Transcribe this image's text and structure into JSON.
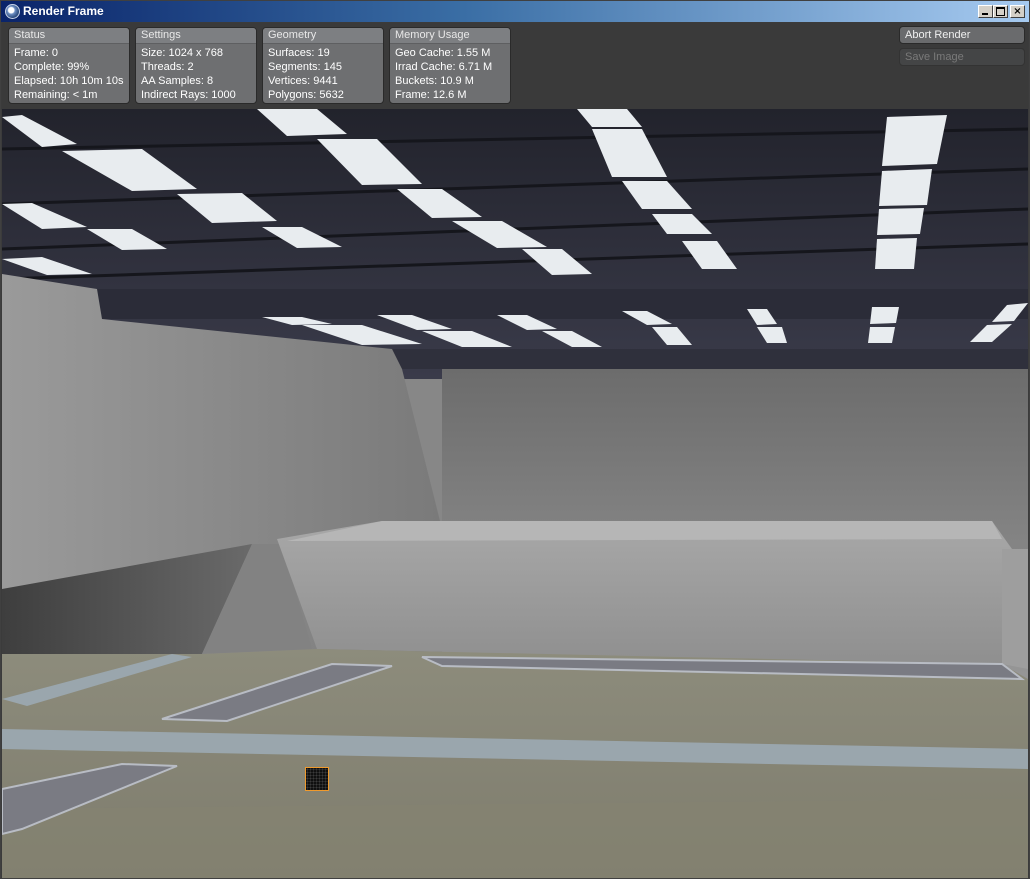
{
  "window": {
    "title": "Render Frame",
    "close_glyph": "×",
    "icon": "render-icon"
  },
  "panels": {
    "status": {
      "title": "Status",
      "rows": [
        "Frame: 0",
        "Complete: 99%",
        "Elapsed: 10h 10m 10s",
        "Remaining: < 1m"
      ]
    },
    "settings": {
      "title": "Settings",
      "rows": [
        "Size: 1024 x 768",
        "Threads: 2",
        "AA Samples: 8",
        "Indirect Rays: 1000"
      ]
    },
    "geometry": {
      "title": "Geometry",
      "rows": [
        "Surfaces: 19",
        "Segments: 145",
        "Vertices: 9441",
        "Polygons: 5632"
      ]
    },
    "memory": {
      "title": "Memory Usage",
      "rows": [
        "Geo Cache: 1.55 M",
        "Irrad Cache: 6.71 M",
        "Buckets: 10.9 M",
        "Frame: 12.6 M"
      ]
    }
  },
  "buttons": {
    "abort": "Abort Render",
    "save": "Save Image"
  },
  "render": {
    "complete_fraction": 0.99
  }
}
